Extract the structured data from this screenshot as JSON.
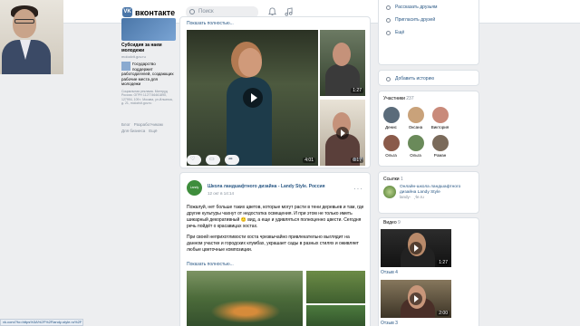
{
  "header": {
    "logo_text": "вконтакте",
    "search_placeholder": "Поиск"
  },
  "left_ad": {
    "title": "Субсидия за наем молодежи",
    "source": "molodvit.gov.ru",
    "text": "Государство поддержит работодателей, создающих рабочие места для молодежи",
    "small": "Социальная реклама. Минтруд России. ОГРН 1127746461890, 127994, 109 г. Москва, ул.Ильинка, д. 21, molodvit.gov.ru",
    "links": [
      "Блог",
      "Разработчикам",
      "Для бизнеса",
      "Ещё"
    ]
  },
  "post1": {
    "show_more": "Показать полностью...",
    "main_duration": "4:01",
    "side_durations": [
      "1:27",
      "6:17"
    ],
    "views": "44"
  },
  "post2": {
    "avatar_text": "Landy Style",
    "name": "Школа ландшафтного дизайна - Landy Style. Россия",
    "date": "12 окт в 14:14",
    "text_p1": "Пожалуй, нет больше таких цветов, которые могут расти в тени деревьев и там, где другие культуры чахнут от недостатка освещения. И при этом не только иметь шикарный декоративный 🙂 вид, а еще и удивляться полноценно цвести. Сегодня речь пойдёт о красавицах хостах.",
    "text_p2": "При своей неприхотливости хоста чрезвычайно привлекательно выглядит на данном участке и городских клумбах, украшает сады в разных стилях и оживляет любые цветочные композиции.",
    "show_more": "Показать полностью..."
  },
  "right_menu": {
    "items": [
      "Рассказать друзьям",
      "Пригласить друзей",
      "Ещё"
    ],
    "stories": "Добавить историю"
  },
  "members": {
    "title": "Участники",
    "count": "237",
    "people": [
      {
        "name": "Денис",
        "color": "#5a6b7a"
      },
      {
        "name": "Оксана",
        "color": "#c9a27a"
      },
      {
        "name": "Виктория",
        "color": "#c98a7a"
      },
      {
        "name": "Ольга",
        "color": "#8a5a4a"
      },
      {
        "name": "Ольга",
        "color": "#6a8a5a"
      },
      {
        "name": "Роман",
        "color": "#7a6a5a"
      }
    ]
  },
  "links_block": {
    "title": "Ссылки",
    "count": "1",
    "link_title": "Онлайн-школа ландшафтного дизайна Landy Style",
    "link_url": "landy-style.ru"
  },
  "videos_block": {
    "title": "Видео",
    "count": "9",
    "items": [
      {
        "title": "Отзыв 4",
        "duration": "1:27"
      },
      {
        "title": "Отзыв 3",
        "duration": "2:00"
      }
    ]
  },
  "status_url": "vk.com/?to=https%3A%2F%2Flandy-style.ru%2F"
}
